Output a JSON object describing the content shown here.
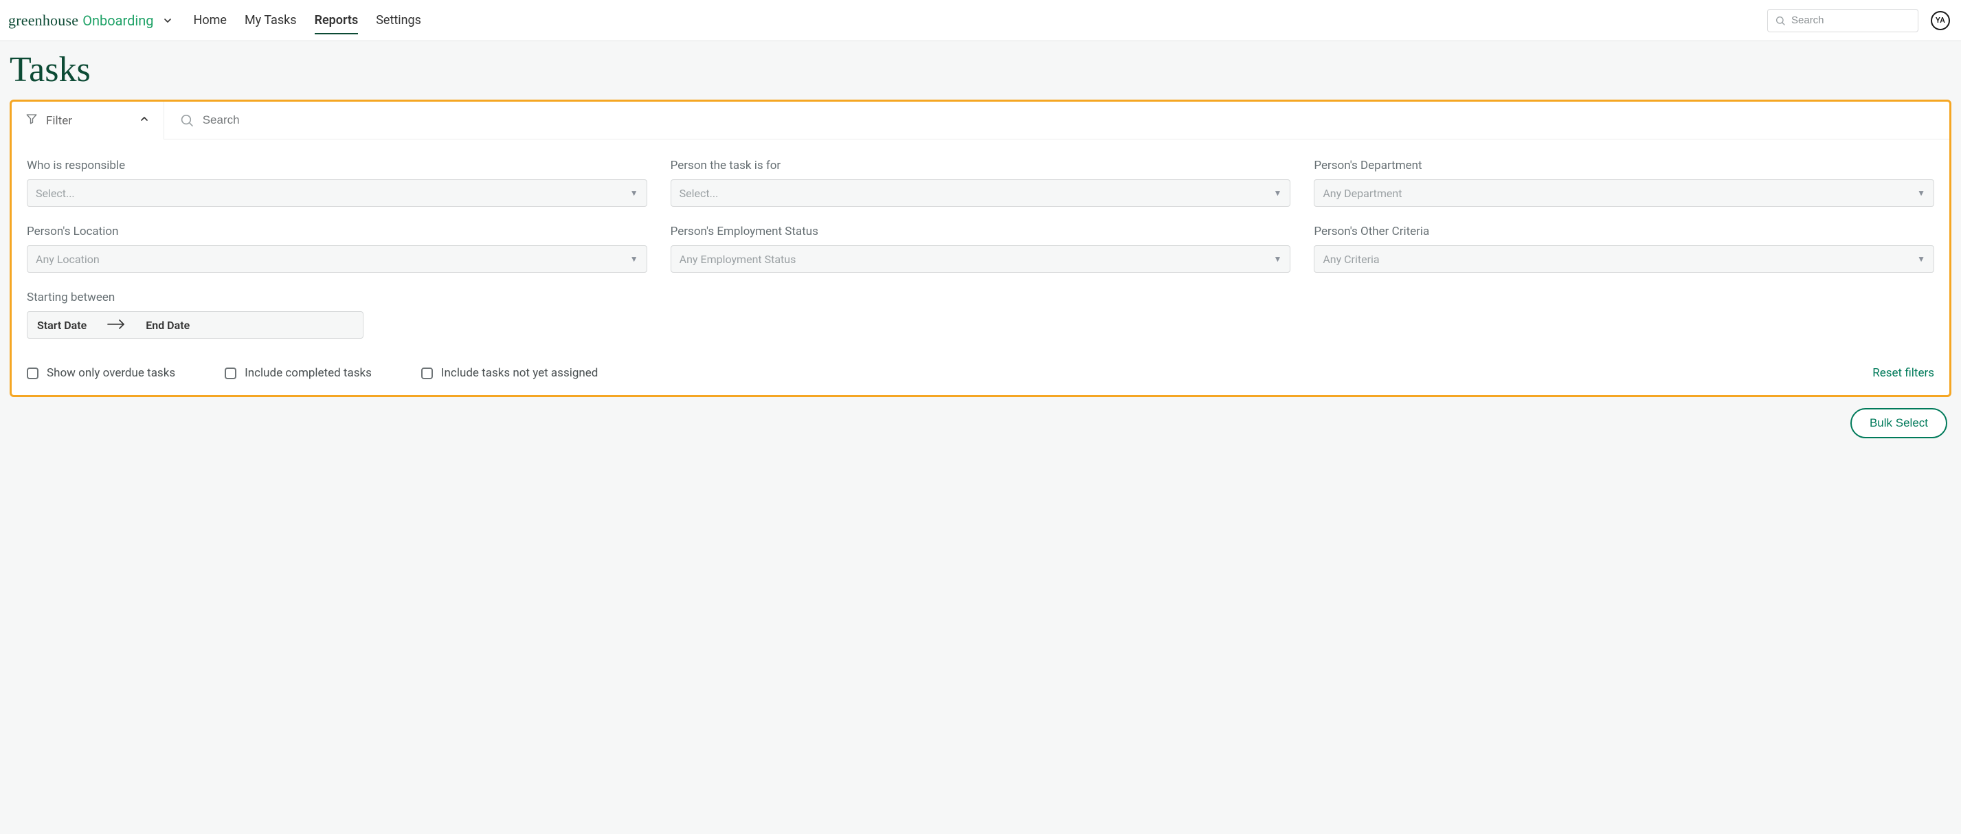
{
  "brand": {
    "primary": "greenhouse",
    "secondary": "Onboarding"
  },
  "nav": {
    "home": "Home",
    "my_tasks": "My Tasks",
    "reports": "Reports",
    "settings": "Settings",
    "active": "reports"
  },
  "global_search": {
    "placeholder": "Search"
  },
  "avatar": {
    "initials": "YA"
  },
  "page": {
    "title": "Tasks"
  },
  "filter_panel": {
    "toggle_label": "Filter",
    "search_placeholder": "Search",
    "fields": {
      "responsible": {
        "label": "Who is responsible",
        "placeholder": "Select..."
      },
      "person_for": {
        "label": "Person the task is for",
        "placeholder": "Select..."
      },
      "department": {
        "label": "Person's Department",
        "placeholder": "Any Department"
      },
      "location": {
        "label": "Person's Location",
        "placeholder": "Any Location"
      },
      "employment_status": {
        "label": "Person's Employment Status",
        "placeholder": "Any Employment Status"
      },
      "other_criteria": {
        "label": "Person's Other Criteria",
        "placeholder": "Any Criteria"
      },
      "starting_between": {
        "label": "Starting between",
        "start": "Start Date",
        "end": "End Date"
      }
    },
    "checkboxes": {
      "overdue": "Show only overdue tasks",
      "completed": "Include completed tasks",
      "not_assigned": "Include tasks not yet assigned"
    },
    "reset": "Reset filters"
  },
  "bulk_select": "Bulk Select"
}
